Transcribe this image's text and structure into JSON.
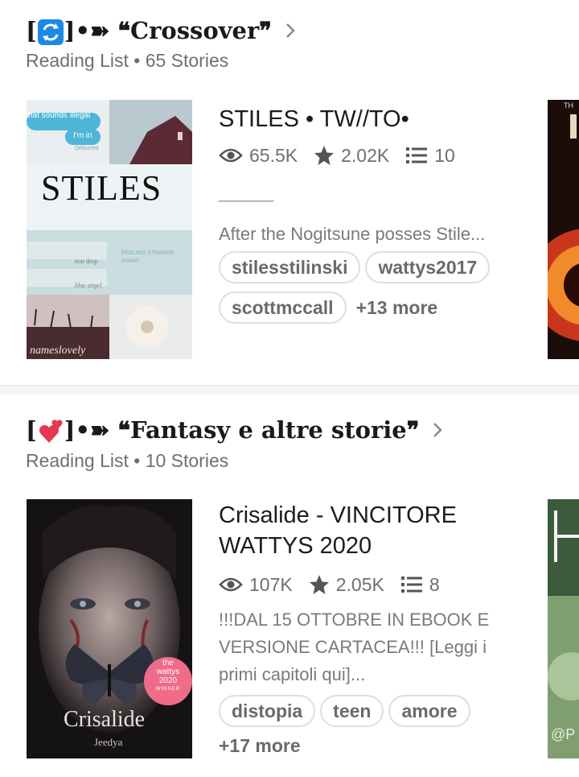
{
  "lists": [
    {
      "bracket_open": "[",
      "bracket_close": "]•➽",
      "emoji": "arrows-repeat-icon",
      "title": "❝Crossover❞",
      "subtitle": "Reading List • 65 Stories",
      "story": {
        "title": "STILES • TW//TO•",
        "views": "65.5K",
        "votes": "2.02K",
        "parts": "10",
        "dash": "______",
        "description": "After the Nogitsune posses Stile...",
        "tags": [
          "stilesstilinski",
          "wattys2017",
          "scottmccall"
        ],
        "more_tags": "+13 more",
        "cover": {
          "chat_1": "hat sounds illegal",
          "chat_2": "I'm in",
          "chat_3": "Delivered",
          "big_title": "STILES",
          "row_1": "tear drop",
          "row_2": "FEELING STRANGE AGAIN",
          "row_3": "blue angel",
          "credit": "nameslovely"
        }
      },
      "peek_text": "TH"
    },
    {
      "bracket_open": "[",
      "bracket_close": "]•➽",
      "emoji": "revolving-hearts-icon",
      "title": "❝Fantasy e altre storie❞",
      "subtitle": "Reading List • 10 Stories",
      "story": {
        "title": "Crisalide - VINCITORE WATTYS 2020",
        "views": "107K",
        "votes": "2.05K",
        "parts": "8",
        "description": "!!!DAL 15 OTTOBRE IN EBOOK E VERSIONE CARTACEA!!! [Leggi i primi capitoli qui]...",
        "tags": [
          "distopia",
          "teen",
          "amore"
        ],
        "more_tags": "+17 more",
        "cover": {
          "big_title": "Crisalide",
          "author": "Jeedya",
          "badge_1": "the",
          "badge_2": "wattys",
          "badge_3": "2020",
          "badge_4": "WINNER"
        }
      },
      "peek_text": "@P"
    }
  ],
  "colors": {
    "tag_border": "#dedede",
    "muted_text": "#6f6f6f",
    "divider": "#f4f4f4",
    "blue_emoji": "#1e88e5",
    "heart_red": "#e53950"
  }
}
